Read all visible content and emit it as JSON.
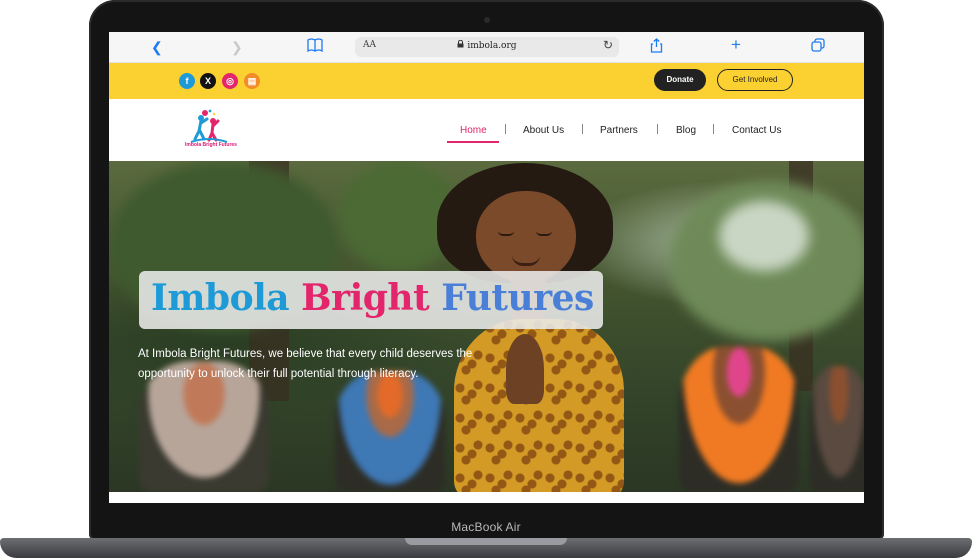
{
  "device": {
    "label": "MacBook Air"
  },
  "browser": {
    "address_text_size": "AA",
    "url": "imbola.org",
    "icons": [
      "back-icon",
      "forward-icon",
      "bookmarks-icon",
      "lock-icon",
      "reload-icon",
      "share-icon",
      "new-tab-icon",
      "tabs-icon"
    ]
  },
  "topbar": {
    "social": [
      {
        "name": "facebook",
        "glyph": "f",
        "color": "#1e9bd7"
      },
      {
        "name": "x",
        "glyph": "X",
        "color": "#111111"
      },
      {
        "name": "instagram",
        "glyph": "◎",
        "color": "#e3256b"
      },
      {
        "name": "substack",
        "glyph": "▤",
        "color": "#f28c28"
      }
    ],
    "donate_label": "Donate",
    "involved_label": "Get Involved"
  },
  "nav": {
    "logo_text": "Imbola Bright Futures",
    "items": [
      {
        "label": "Home",
        "active": true
      },
      {
        "label": "About Us"
      },
      {
        "label": "Partners"
      },
      {
        "label": "Blog"
      },
      {
        "label": "Contact Us"
      }
    ]
  },
  "hero": {
    "title_part1": "Imbola",
    "title_part2": "Bright",
    "title_part3": "Futures",
    "text": "At Imbola Bright Futures, we believe that every child deserves the opportunity to unlock their full potential through literacy."
  },
  "colors": {
    "yellow": "#fbd132",
    "pink": "#e3256b",
    "blue": "#1e9bd7"
  }
}
